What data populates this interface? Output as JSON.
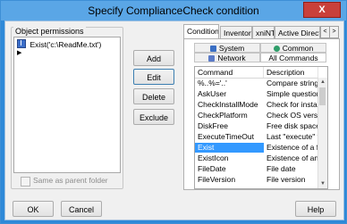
{
  "window": {
    "title": "Specify ComplianceCheck condition",
    "close_glyph": "X"
  },
  "left": {
    "group_label": "Object permissions",
    "items": [
      {
        "icon": "condition-icon",
        "text": "Exist('c:\\ReadMe.txt')"
      }
    ],
    "arrow_glyph": "▶",
    "same_as_parent_label": "Same as parent folder",
    "same_as_parent_checked": false
  },
  "actions": {
    "add": "Add",
    "edit": "Edit",
    "delete": "Delete",
    "exclude": "Exclude"
  },
  "right": {
    "tabs": [
      "Conditions",
      "Inventory",
      "xniNT",
      "Active Directory"
    ],
    "active_tab": "Conditions",
    "tab_scroll_left": "<",
    "tab_scroll_right": ">",
    "categories": [
      {
        "label": "System",
        "icon": "system-icon",
        "color": "#3a6fc4"
      },
      {
        "label": "Common",
        "icon": "globe-icon",
        "color": "#2f9e6a"
      },
      {
        "label": "Network",
        "icon": "network-icon",
        "color": "#5a7ac7"
      },
      {
        "label": "All Commands",
        "icon": "",
        "color": ""
      }
    ],
    "active_category": "All Commands",
    "columns": [
      "Command",
      "Description"
    ],
    "rows": [
      {
        "command": "%..%='..'",
        "description": "Compare strings"
      },
      {
        "command": "AskUser",
        "description": "Simple question me"
      },
      {
        "command": "CheckInstallMode",
        "description": "Check for installatio"
      },
      {
        "command": "CheckPlatform",
        "description": "Check OS version"
      },
      {
        "command": "DiskFree",
        "description": "Free disk space"
      },
      {
        "command": "ExecuteTimeOut",
        "description": "Last \"execute\" term"
      },
      {
        "command": "Exist",
        "description": "Existence of a file"
      },
      {
        "command": "ExistIcon",
        "description": "Existence of an icon"
      },
      {
        "command": "FileDate",
        "description": "File date"
      },
      {
        "command": "FileVersion",
        "description": "File version"
      }
    ],
    "selected_row": "Exist",
    "scroll_up": "▲",
    "scroll_down": "▼"
  },
  "footer": {
    "ok": "OK",
    "cancel": "Cancel",
    "help": "Help"
  }
}
